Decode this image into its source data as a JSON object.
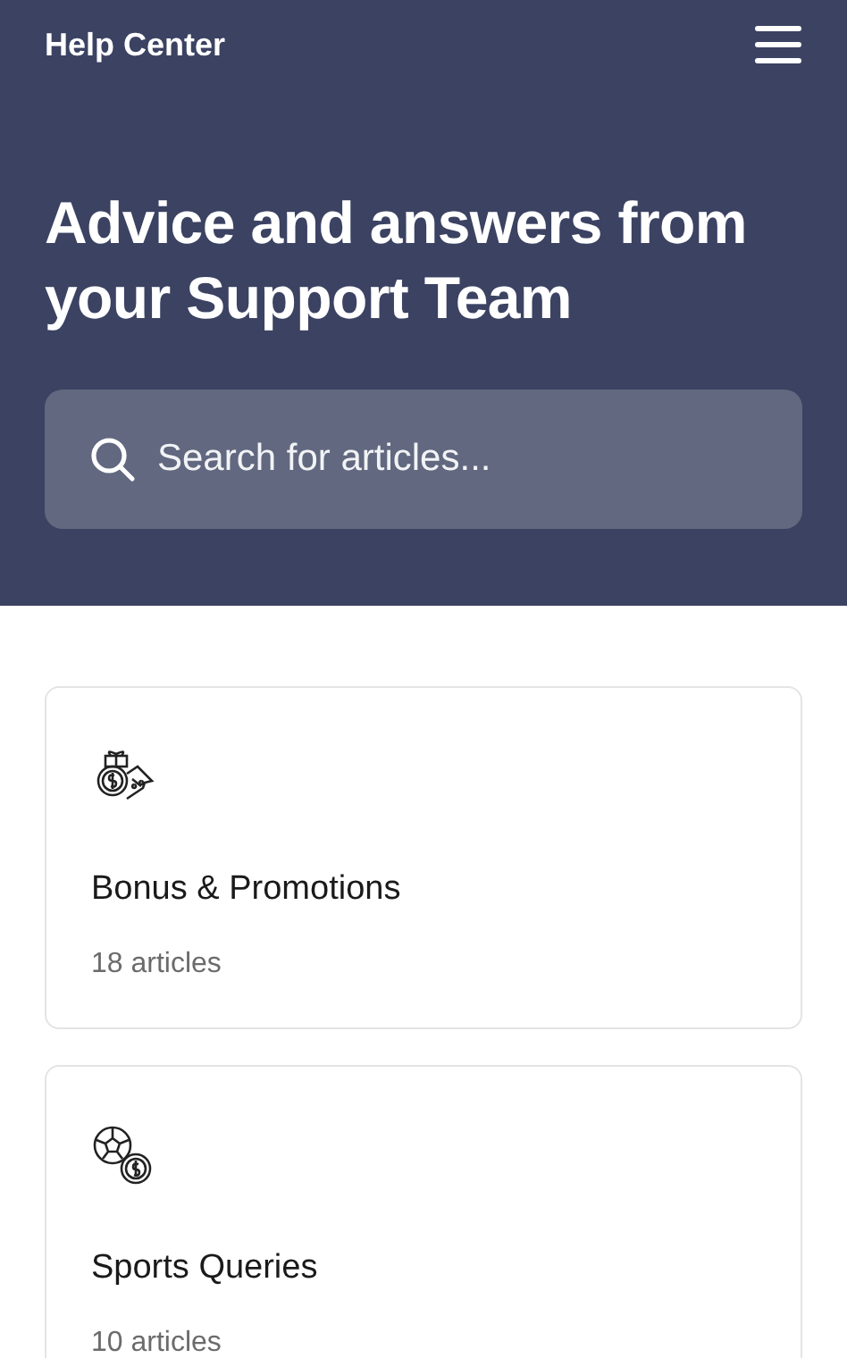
{
  "header": {
    "title": "Help Center"
  },
  "hero": {
    "heading": "Advice and answers from your Support Team"
  },
  "search": {
    "placeholder": "Search for articles..."
  },
  "collections": [
    {
      "kind": "bonus",
      "title": "Bonus & Promotions",
      "count": "18 articles"
    },
    {
      "kind": "sports",
      "title": "Sports Queries",
      "count": "10 articles"
    }
  ]
}
